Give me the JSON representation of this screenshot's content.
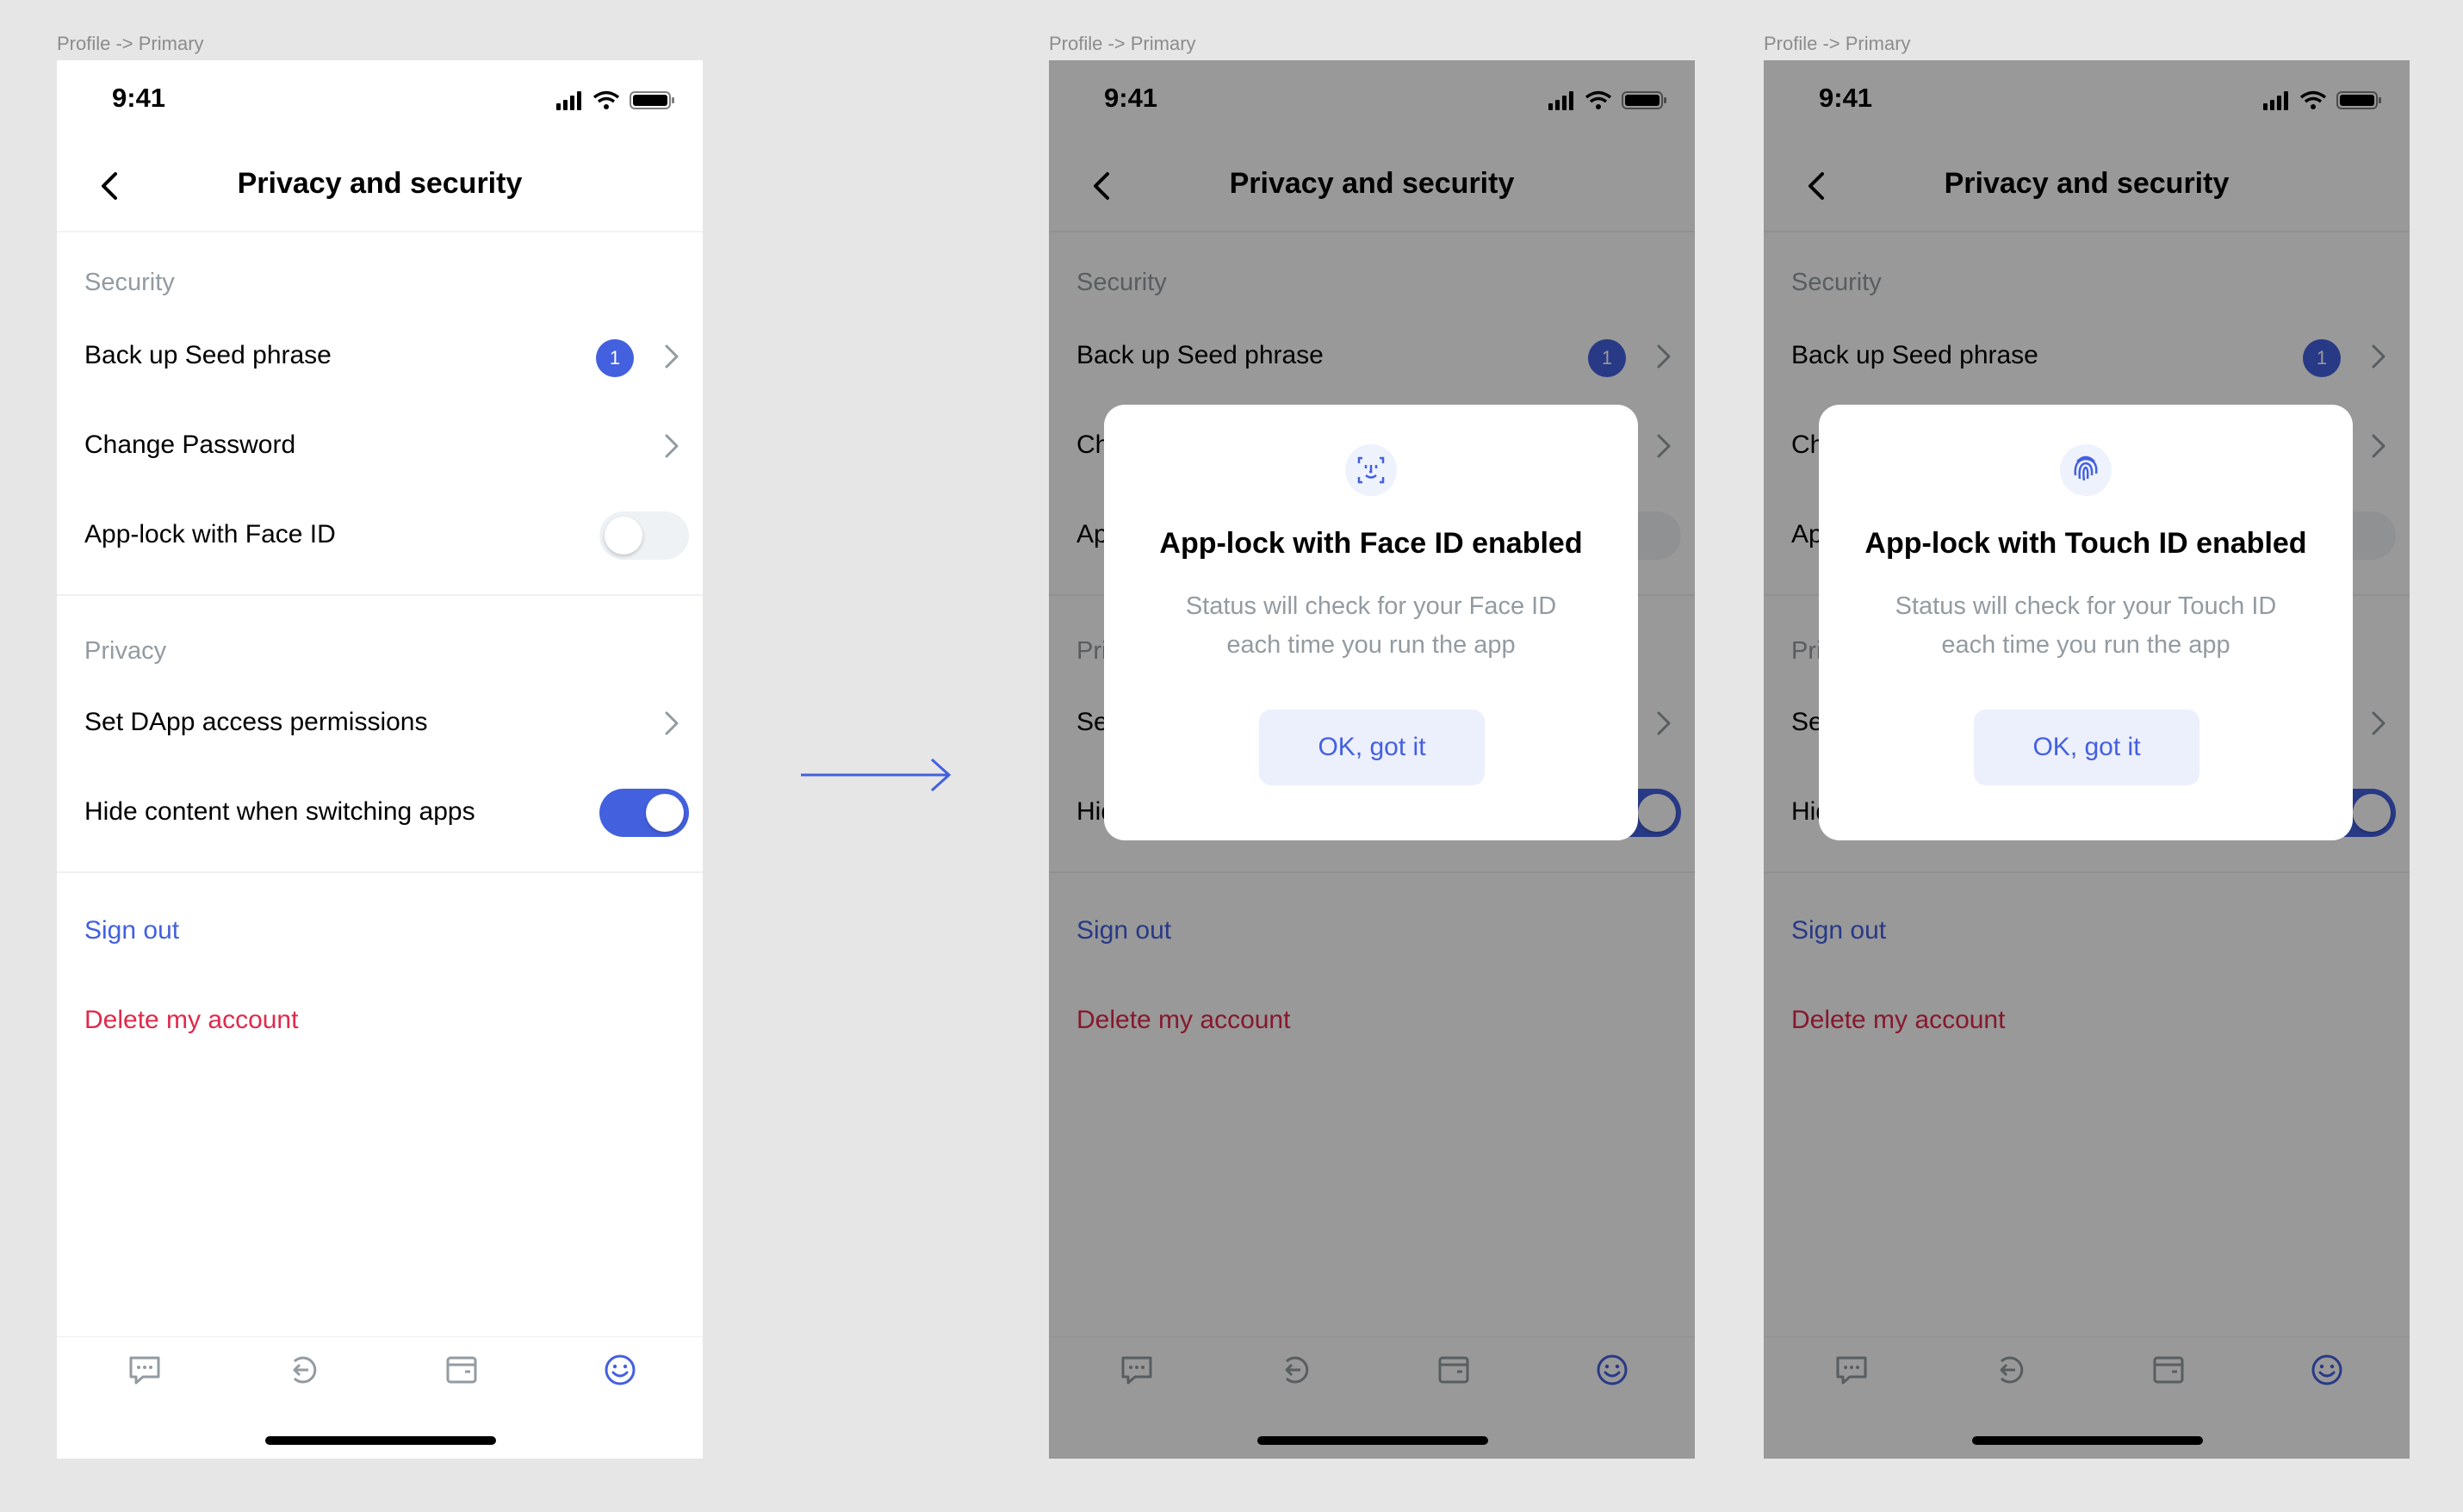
{
  "frames": [
    {
      "label": "Profile -> Primary",
      "modal": null
    },
    {
      "label": "Profile -> Primary",
      "modal": {
        "icon": "face-id-icon",
        "title": "App-lock with Face ID enabled",
        "text_line1": "Status will check for your Face ID",
        "text_line2": "each time you run the app",
        "button": "OK, got it"
      }
    },
    {
      "label": "Profile -> Primary",
      "modal": {
        "icon": "fingerprint-icon",
        "title": "App-lock with Touch ID enabled",
        "text_line1": "Status will check for your Touch ID",
        "text_line2": "each time you run the app",
        "button": "OK, got it"
      }
    }
  ],
  "screen": {
    "time": "9:41",
    "title": "Privacy and security",
    "security_header": "Security",
    "backup": {
      "label": "Back up Seed phrase",
      "badge": "1"
    },
    "change_password": "Change Password",
    "app_lock": {
      "label": "App-lock with Face ID",
      "on": false
    },
    "privacy_header": "Privacy",
    "dapp_permissions": "Set DApp access permissions",
    "hide_content": {
      "label": "Hide content when switching apps",
      "on": true
    },
    "sign_out": "Sign out",
    "delete_account": "Delete my account",
    "tabs": [
      "chat-icon",
      "browser-icon",
      "wallet-icon",
      "profile-icon"
    ]
  },
  "colors": {
    "accent": "#4360df",
    "danger": "#e0294b",
    "secondary_text": "#939ba1",
    "overlay": "rgba(0,0,0,0.4)"
  }
}
